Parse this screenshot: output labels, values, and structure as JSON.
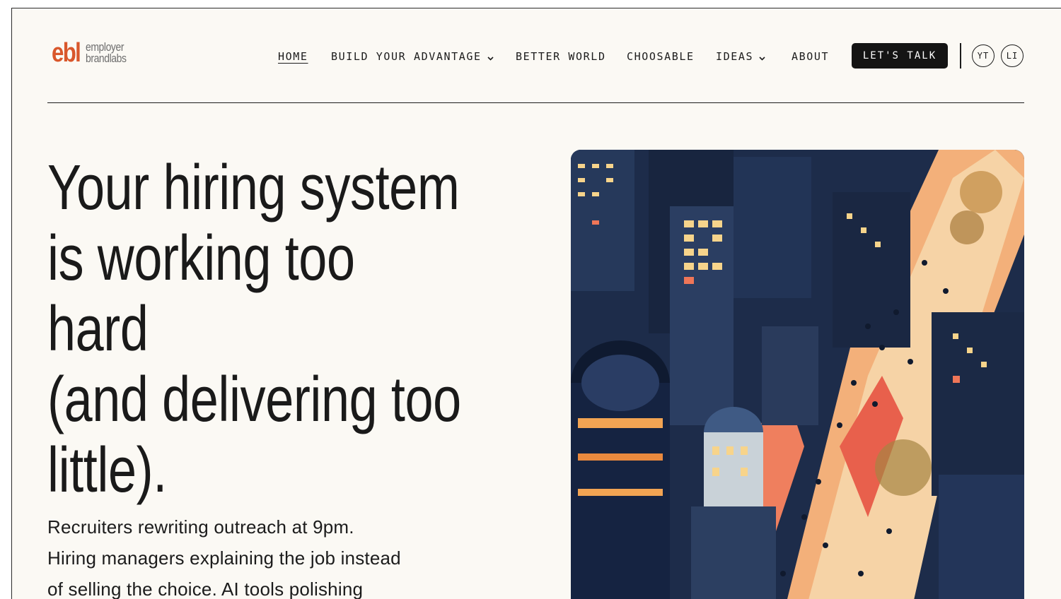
{
  "brand": {
    "mark": "ebl",
    "line1": "employer",
    "line2": "brandlabs",
    "accent_color": "#d9572b"
  },
  "nav": {
    "items": [
      {
        "label": "HOME",
        "active": true,
        "dropdown": false
      },
      {
        "label": "BUILD YOUR ADVANTAGE",
        "active": false,
        "dropdown": true
      },
      {
        "label": "BETTER WORLD",
        "active": false,
        "dropdown": false
      },
      {
        "label": "CHOOSABLE",
        "active": false,
        "dropdown": false
      },
      {
        "label": "IDEAS",
        "active": false,
        "dropdown": true
      },
      {
        "label": "ABOUT",
        "active": false,
        "dropdown": false
      }
    ],
    "cta_label": "LET'S TALK",
    "social": [
      "YT",
      "LI"
    ]
  },
  "hero": {
    "headline_lines": [
      "Your hiring system",
      "is working too",
      "hard",
      "(and delivering too",
      "little)."
    ],
    "sub_lines": [
      "Recruiters rewriting outreach at 9pm.",
      "Hiring managers explaining the job instead",
      "of selling the choice. AI tools polishing"
    ],
    "image_description_icon": "city-illustration-icon"
  },
  "colors": {
    "background": "#fbf9f4",
    "ink": "#1c1c1c",
    "cta_bg": "#141414"
  }
}
